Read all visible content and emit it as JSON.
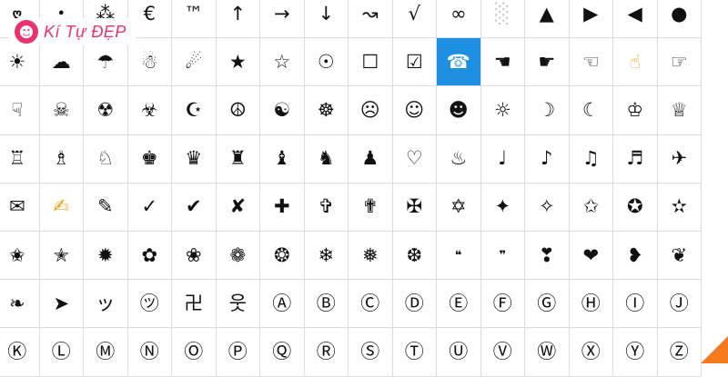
{
  "brand": {
    "logo_icon": "smiling-face-logo-icon",
    "logo_text": "Kí Tự ĐẸP",
    "accent": "#e8336d"
  },
  "grid": {
    "highlight_color": "#1e8fe1",
    "rows": [
      [
        "ღ",
        "•",
        "⁂",
        "€",
        "™",
        "↑",
        "→",
        "↓",
        "↝",
        "√",
        "∞",
        "░",
        "▲",
        "▶",
        "◀",
        "●"
      ],
      [
        "☀",
        "☁",
        "☂",
        "☃",
        "☄",
        "★",
        "☆",
        "☉",
        "☐",
        "☑",
        "☎",
        "☚",
        "☛",
        "☜",
        "☝",
        "☞"
      ],
      [
        "☟",
        "☠",
        "☢",
        "☣",
        "☪",
        "☮",
        "☯",
        "☸",
        "☹",
        "☺",
        "☻",
        "☼",
        "☽",
        "☾",
        "♔",
        "♕"
      ],
      [
        "♖",
        "♗",
        "♘",
        "♚",
        "♛",
        "♜",
        "♝",
        "♞",
        "♟",
        "♡",
        "♨",
        "♩",
        "♪",
        "♫",
        "♬",
        "✈"
      ],
      [
        "✉",
        "✍",
        "✎",
        "✓",
        "✔",
        "✘",
        "✚",
        "✞",
        "✟",
        "✠",
        "✡",
        "✦",
        "✧",
        "✩",
        "✪",
        "✫"
      ],
      [
        "✬",
        "✭",
        "✹",
        "✿",
        "❀",
        "❁",
        "❂",
        "❄",
        "❅",
        "❆",
        "❝",
        "❞",
        "❣",
        "❤",
        "❥",
        "❦"
      ],
      [
        "❧",
        "➤",
        "ッ",
        "㋡",
        "卍",
        "웃",
        "Ⓐ",
        "Ⓑ",
        "Ⓒ",
        "Ⓓ",
        "Ⓔ",
        "Ⓕ",
        "Ⓖ",
        "Ⓗ",
        "Ⓘ",
        "Ⓙ"
      ],
      [
        "Ⓚ",
        "Ⓛ",
        "Ⓜ",
        "Ⓝ",
        "Ⓞ",
        "Ⓟ",
        "Ⓠ",
        "Ⓡ",
        "Ⓢ",
        "Ⓣ",
        "Ⓤ",
        "Ⓥ",
        "Ⓦ",
        "Ⓧ",
        "Ⓨ",
        "Ⓩ"
      ]
    ]
  }
}
